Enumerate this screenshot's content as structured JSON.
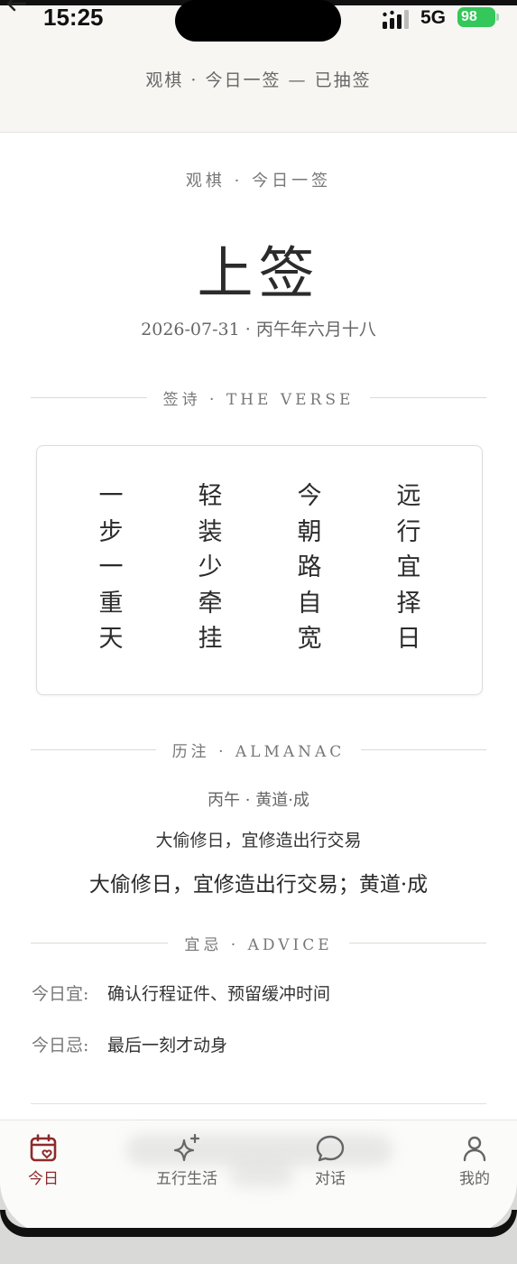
{
  "status_bar": {
    "time": "15:25",
    "network": "5G",
    "battery": "98"
  },
  "header": {
    "title": "观棋 · 今日一签 — 已抽签"
  },
  "lot": {
    "subtitle": "观棋 · 今日一签",
    "grade": "上签",
    "date": "2026-07-31 · 丙午年六月十八"
  },
  "verse": {
    "section_label": "签诗 · THE VERSE",
    "columns": [
      "一步一重天",
      "轻装少牵挂",
      "今朝路自宽",
      "远行宜择日"
    ]
  },
  "almanac": {
    "section_label": "历注 · ALMANAC",
    "line1": "丙午 · 黄道·成",
    "line2": "大偷修日，宜修造出行交易",
    "line3": "大偷修日，宜修造出行交易；黄道·成"
  },
  "advice": {
    "section_label": "宜忌 · ADVICE",
    "do_label": "今日宜:",
    "do_value": "确认行程证件、预留缓冲时间",
    "dont_label": "今日忌:",
    "dont_value": "最后一刻才动身"
  },
  "tabs": [
    {
      "label": "今日",
      "icon": "calendar-heart-icon",
      "active": true
    },
    {
      "label": "五行生活",
      "icon": "sparkles-icon",
      "active": false
    },
    {
      "label": "对话",
      "icon": "chat-bubble-icon",
      "active": false
    },
    {
      "label": "我的",
      "icon": "person-icon",
      "active": false
    }
  ],
  "colors": {
    "accent": "#8e2a2a",
    "battery": "#34c759"
  }
}
